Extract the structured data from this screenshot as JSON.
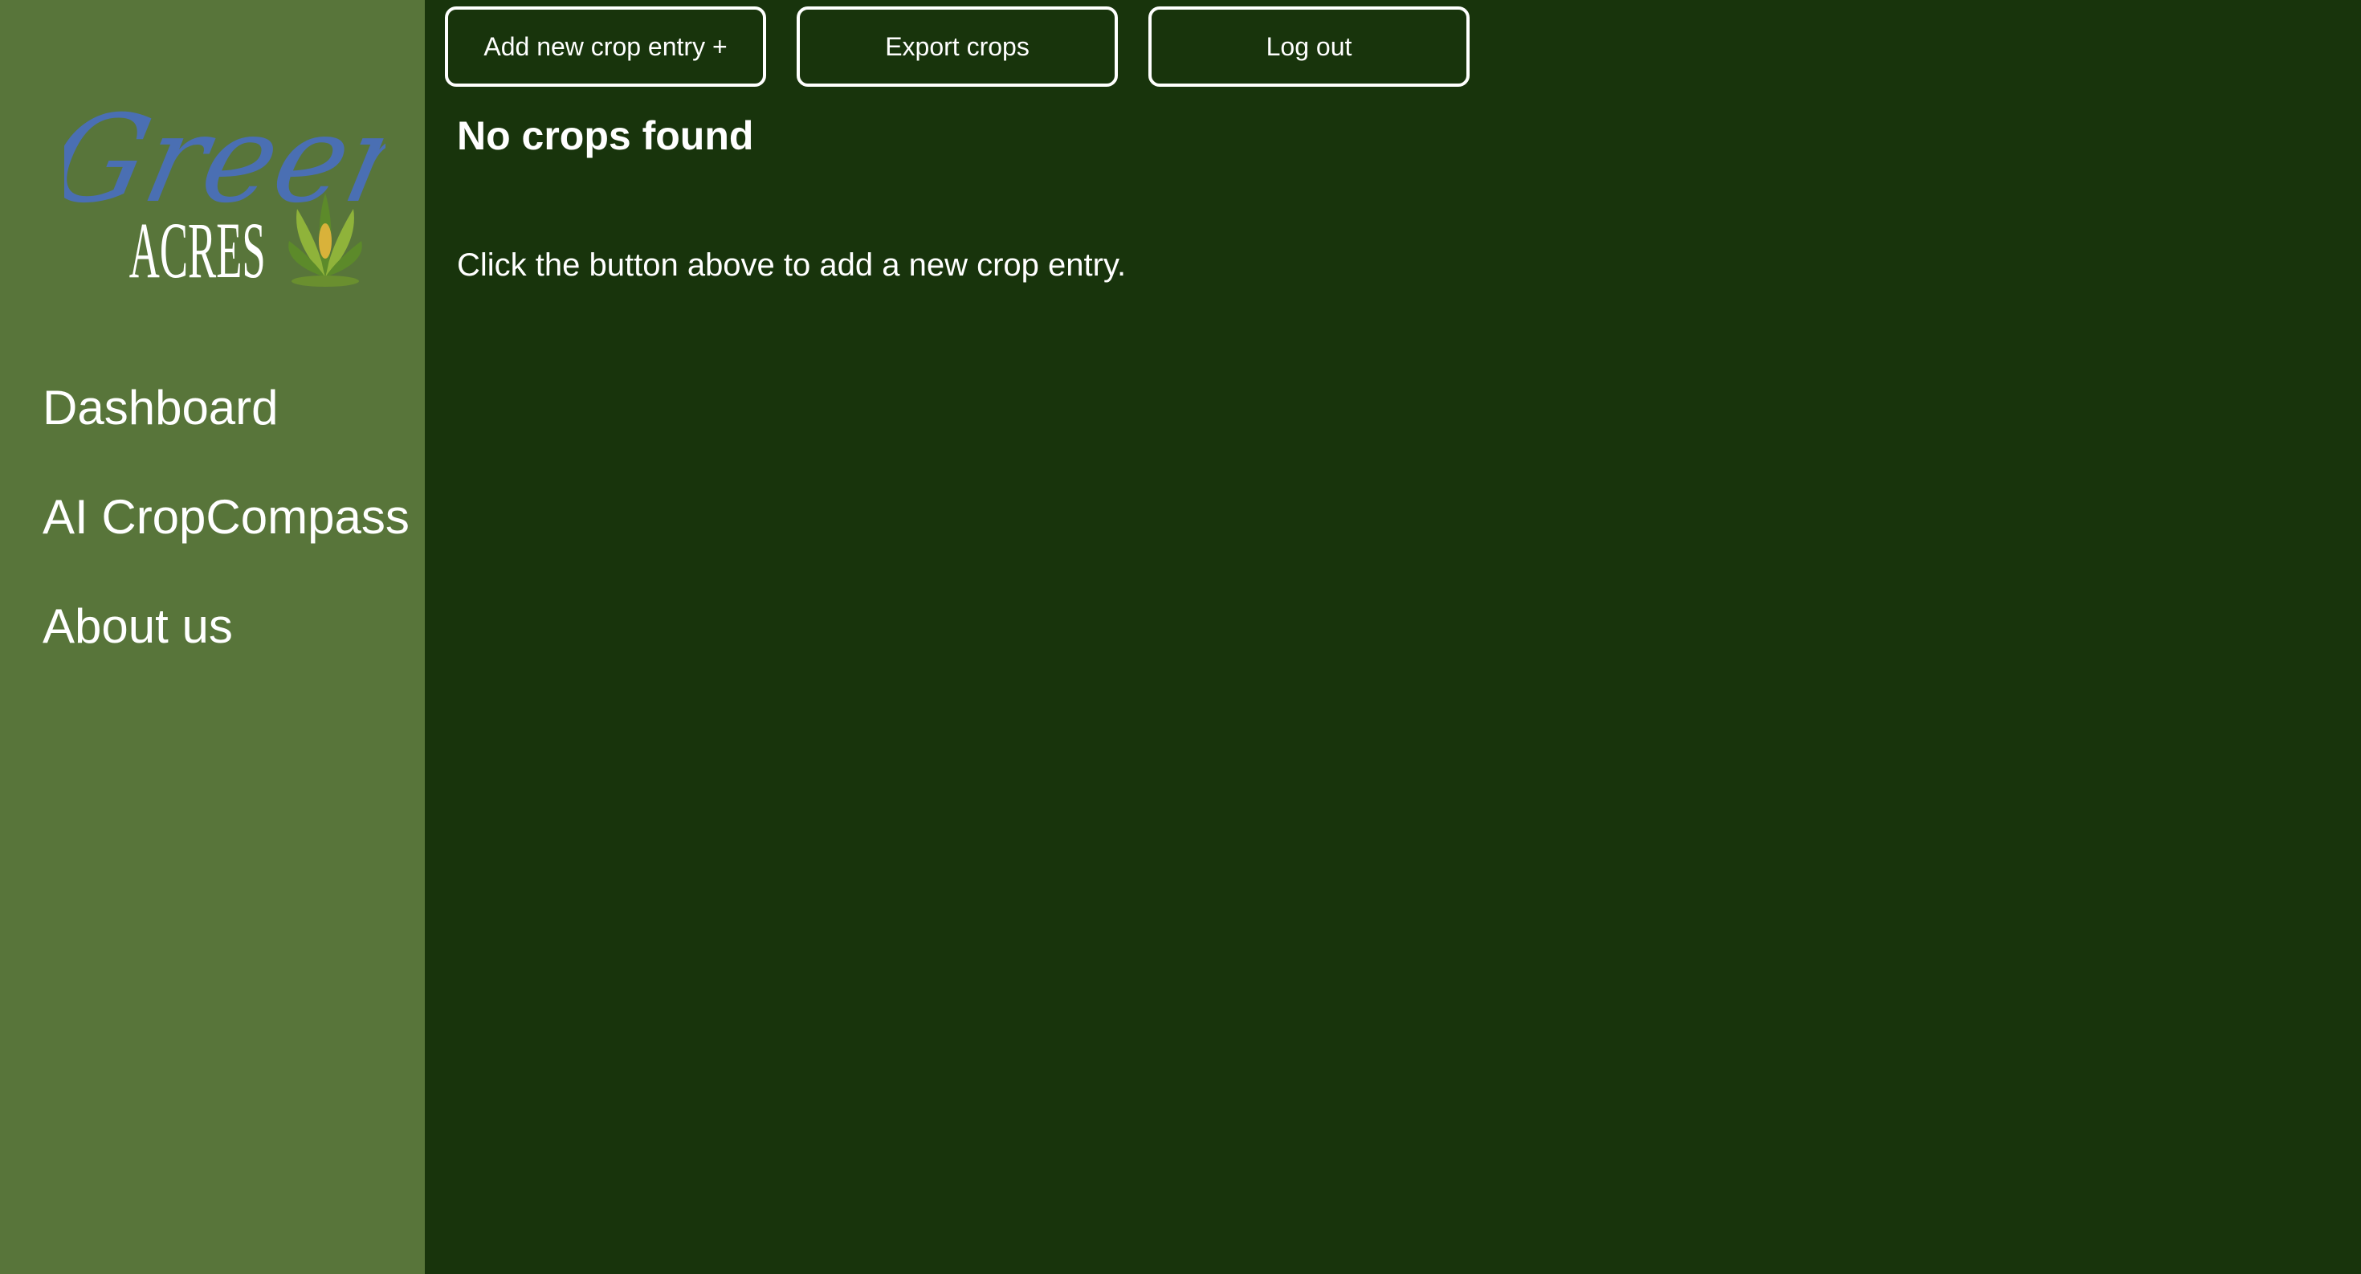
{
  "sidebar": {
    "logo": {
      "script_text": "Green",
      "main_text": "ACRES",
      "icon": "wheat-sprout-icon",
      "colors": {
        "script": "#4a6fb3",
        "main": "#ffffff",
        "leaves": "#8fb33a",
        "leaves_dark": "#5c8a2a",
        "grain": "#d9b23a"
      }
    },
    "nav_items": [
      {
        "label": "Dashboard"
      },
      {
        "label": "AI CropCompass"
      },
      {
        "label": "About us"
      }
    ]
  },
  "toolbar": {
    "add_label": "Add new crop entry +",
    "export_label": "Export crops",
    "logout_label": "Log out"
  },
  "main": {
    "empty_title": "No crops found",
    "empty_hint": "Click the button above to add a new crop entry."
  },
  "colors": {
    "sidebar_bg": "#58753a",
    "main_bg": "#18340c",
    "text": "#ffffff",
    "button_border": "#ffffff"
  }
}
